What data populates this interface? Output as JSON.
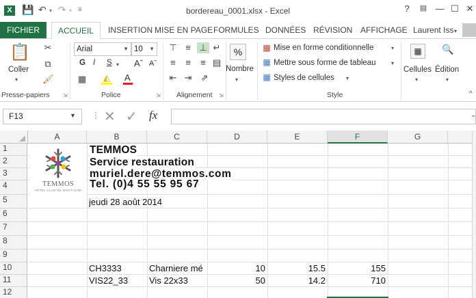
{
  "window": {
    "title": "bordereau_0001.xlsx - Excel",
    "controls": [
      "?",
      "—",
      "☐",
      "✕"
    ]
  },
  "tabs": {
    "file": "FICHIER",
    "active": "ACCUEIL",
    "others": [
      "INSERTION",
      "MISE EN PAGE",
      "FORMULES",
      "DONNÉES",
      "RÉVISION",
      "AFFICHAGE"
    ],
    "user": "Laurent Iss"
  },
  "ribbon": {
    "clipboard": {
      "paste": "Coller",
      "label": "Presse-papiers"
    },
    "font": {
      "name": "Arial",
      "size": "10",
      "bold": "G",
      "italic": "I",
      "underline": "S",
      "label": "Police"
    },
    "alignment": {
      "label": "Alignement"
    },
    "number": {
      "symbol": "%",
      "name": "Nombre"
    },
    "styles": {
      "conditional": "Mise en forme conditionnelle",
      "table": "Mettre sous forme de tableau",
      "cell_styles": "Styles de cellules",
      "label": "Style"
    },
    "cells": {
      "label": "Cellules"
    },
    "editing": {
      "label": "Édition"
    }
  },
  "formula_bar": {
    "name_box": "F13",
    "fx": "fx",
    "value": ""
  },
  "grid": {
    "columns": [
      "A",
      "B",
      "C",
      "D",
      "E",
      "F",
      "G"
    ],
    "selected_column": "F",
    "rows": [
      "1",
      "2",
      "3",
      "4",
      "5",
      "6",
      "7",
      "8",
      "9",
      "10",
      "11",
      "12"
    ],
    "logo_text": "TEMMOS",
    "logo_subtext": "HÔTEL CLUB DE MONTAGNE",
    "header_lines": [
      "TEMMOS",
      "Service restauration",
      "muriel.dere@temmos.com",
      "Tel.  (0)4 55 55 95 67"
    ],
    "date": "jeudi 28 août 2014",
    "items": [
      {
        "code": "CH3333",
        "desc": "Charniere mé",
        "qty": "10",
        "price": "15.5",
        "total": "155"
      },
      {
        "code": "VIS22_33",
        "desc": "Vis 22x33",
        "qty": "50",
        "price": "14.2",
        "total": "710"
      }
    ]
  },
  "colors": {
    "excel_green": "#217346",
    "header_bg": "#f3f3f3",
    "gridline": "#e0e0e0"
  }
}
